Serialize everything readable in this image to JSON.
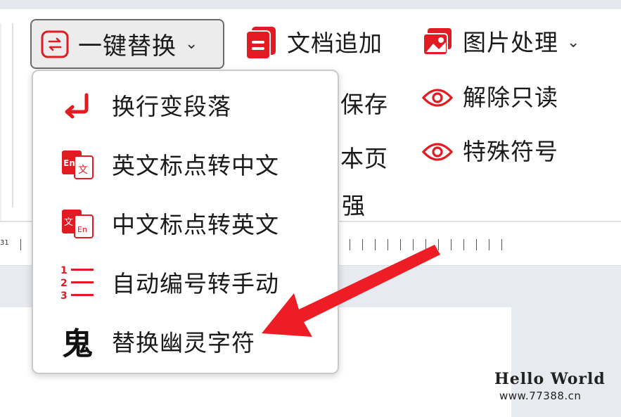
{
  "ribbon": {
    "replace_button": {
      "label": "一键替换",
      "icon": "swap-icon"
    },
    "doc_append": {
      "label": "文档追加",
      "icon": "doc-append-icon"
    },
    "image_process": {
      "label": "图片处理",
      "icon": "image-icon"
    },
    "save_partial": "保存",
    "remove_readonly": {
      "label": "解除只读",
      "icon": "eye-icon"
    },
    "page_partial": "本页",
    "special_symbols": {
      "label": "特殊符号",
      "icon": "eye-icon"
    },
    "enhance_partial": "强"
  },
  "ruler": {
    "number": "31"
  },
  "dropdown": {
    "items": [
      {
        "label": "换行变段落",
        "icon": "line-break-icon"
      },
      {
        "label": "英文标点转中文",
        "icon": "en-to-zh-icon",
        "icon_text_a": "En",
        "icon_text_b": "文"
      },
      {
        "label": "中文标点转英文",
        "icon": "zh-to-en-icon",
        "icon_text_a": "文",
        "icon_text_b": "En"
      },
      {
        "label": "自动编号转手动",
        "icon": "numbering-icon",
        "icon_digits": [
          "1",
          "2",
          "3"
        ]
      },
      {
        "label": "替换幽灵字符",
        "icon": "ghost-char-icon",
        "icon_text": "鬼"
      }
    ]
  },
  "watermark": {
    "line1": "Hello World",
    "line2": "www.77388.cn"
  },
  "colors": {
    "accent": "#e21a22",
    "dropdown_border": "#c9c9c9"
  }
}
